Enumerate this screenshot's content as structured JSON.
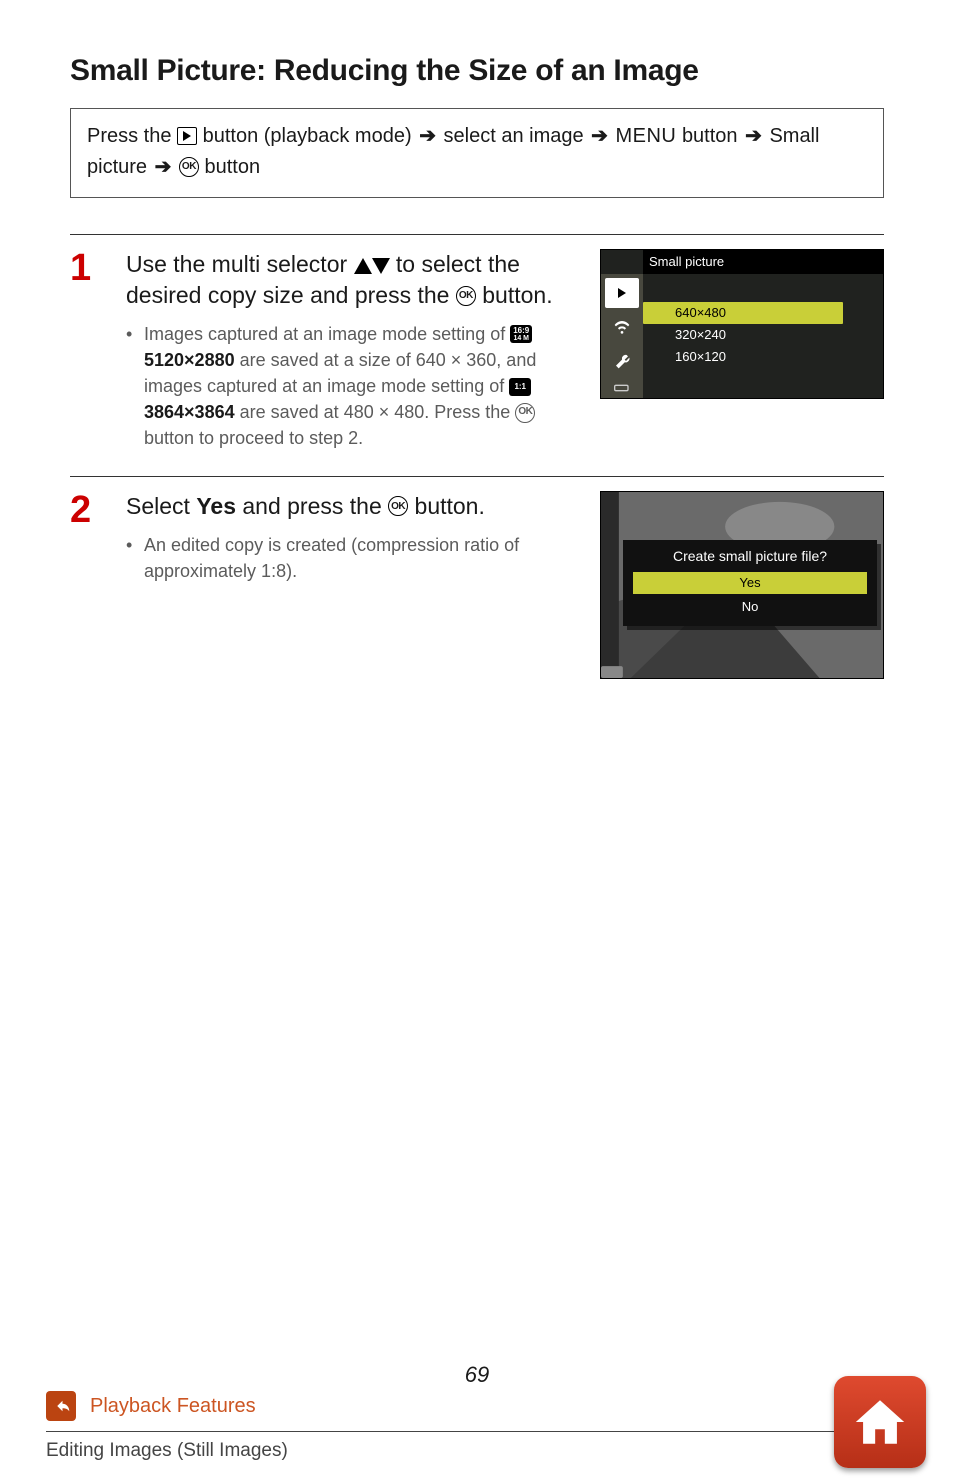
{
  "title": "Small Picture: Reducing the Size of an Image",
  "path": {
    "pre": "Press the ",
    "play_label": "button (playback mode)",
    "sel_image": "select an image",
    "menu": "MENU",
    "menu_suffix": "button",
    "small_picture": "Small picture",
    "ok_suffix": "button"
  },
  "steps": {
    "s1": {
      "num": "1",
      "heading_a": "Use the multi selector ",
      "heading_b": " to select the desired copy size and press the ",
      "heading_c": " button.",
      "bullet_a": "Images captured at an image mode setting of ",
      "b169": "16:9",
      "b169b": "14 M",
      "size1": "5120×2880",
      "bullet_b": " are saved at a size of 640 × 360, and images captured at an image mode setting of ",
      "b11": "1:1",
      "size2": "3864×3864",
      "bullet_c": " are saved at 480 × 480. Press the ",
      "bullet_d": " button to proceed to step 2."
    },
    "s2": {
      "num": "2",
      "heading_a": "Select ",
      "yes": "Yes",
      "heading_b": " and press the ",
      "heading_c": " button.",
      "bullet": "An edited copy is created (compression ratio of approximately 1:8)."
    }
  },
  "shot1": {
    "title": "Small picture",
    "options": [
      "640×480",
      "320×240",
      "160×120"
    ]
  },
  "shot2": {
    "title": "Create small picture file?",
    "yes": "Yes",
    "no": "No"
  },
  "page_number": "69",
  "footer": {
    "section": "Playback Features",
    "subsection": "Editing Images (Still Images)"
  }
}
